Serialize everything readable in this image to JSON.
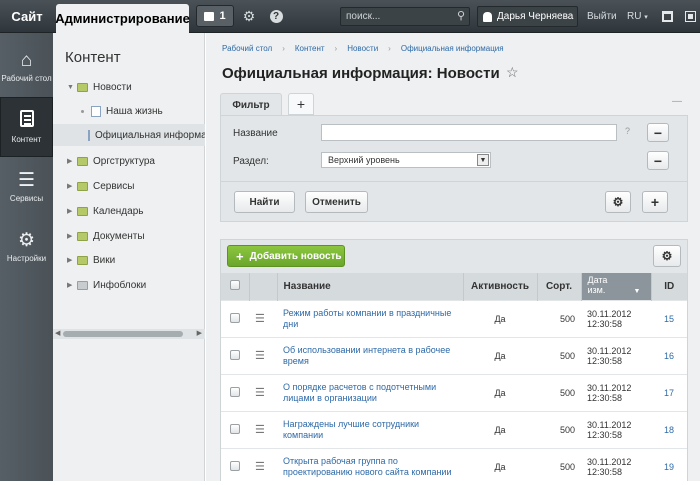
{
  "topbar": {
    "site": "Сайт",
    "admin": "Администрирование",
    "notifications": "1",
    "search_placeholder": "поиск...",
    "user": "Дарья Черняева",
    "logout": "Выйти",
    "lang": "RU"
  },
  "leftnav": {
    "items": [
      {
        "label": "Рабочий стол",
        "icon": "home-icon"
      },
      {
        "label": "Контент",
        "icon": "document-icon"
      },
      {
        "label": "Сервисы",
        "icon": "layers-icon"
      },
      {
        "label": "Настройки",
        "icon": "gear-icon"
      }
    ]
  },
  "tree": {
    "title": "Контент",
    "items": [
      {
        "label": "Новости"
      },
      {
        "label": "Наша жизнь"
      },
      {
        "label": "Официальная информа"
      },
      {
        "label": "Оргструктура"
      },
      {
        "label": "Сервисы"
      },
      {
        "label": "Календарь"
      },
      {
        "label": "Документы"
      },
      {
        "label": "Вики"
      },
      {
        "label": "Инфоблоки"
      }
    ]
  },
  "breadcrumb": [
    "Рабочий стол",
    "Контент",
    "Новости",
    "Официальная информация"
  ],
  "page_title": "Официальная информация: Новости",
  "filter": {
    "tab": "Фильтр",
    "name_label": "Название",
    "name_value": "",
    "help": "?",
    "section_label": "Раздел:",
    "section_value": "Верхний уровень",
    "find": "Найти",
    "cancel": "Отменить"
  },
  "list": {
    "add_button": "Добавить новость",
    "columns": {
      "name": "Название",
      "active": "Активность",
      "sort": "Сорт.",
      "date": "Дата изм.",
      "id": "ID"
    },
    "rows": [
      {
        "title": "Режим работы компании в праздничные дни",
        "active": "Да",
        "sort": "500",
        "date": "30.11.2012",
        "time": "12:30:58",
        "id": "15"
      },
      {
        "title": "Об использовании интернета в рабочее время",
        "active": "Да",
        "sort": "500",
        "date": "30.11.2012",
        "time": "12:30:58",
        "id": "16"
      },
      {
        "title": "О порядке расчетов с подотчетными лицами в организации",
        "active": "Да",
        "sort": "500",
        "date": "30.11.2012",
        "time": "12:30:58",
        "id": "17"
      },
      {
        "title": "Награждены лучшие сотрудники компании",
        "active": "Да",
        "sort": "500",
        "date": "30.11.2012",
        "time": "12:30:58",
        "id": "18"
      },
      {
        "title": "Открыта рабочая группа по проектированию нового сайта компании",
        "active": "Да",
        "sort": "500",
        "date": "30.11.2012",
        "time": "12:30:58",
        "id": "19"
      }
    ]
  }
}
